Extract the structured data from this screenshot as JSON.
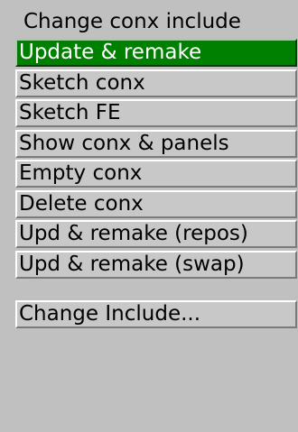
{
  "menu": {
    "title": "Change conx include",
    "items": [
      {
        "label": "Update & remake",
        "active": true
      },
      {
        "label": "Sketch conx",
        "active": false
      },
      {
        "label": "Sketch FE",
        "active": false
      },
      {
        "label": "Show conx & panels",
        "active": false
      },
      {
        "label": "Empty conx",
        "active": false
      },
      {
        "label": "Delete conx",
        "active": false
      },
      {
        "label": "Upd & remake (repos)",
        "active": false
      },
      {
        "label": "Upd & remake (swap)",
        "active": false
      }
    ],
    "footer_item": {
      "label": "Change Include..."
    }
  }
}
